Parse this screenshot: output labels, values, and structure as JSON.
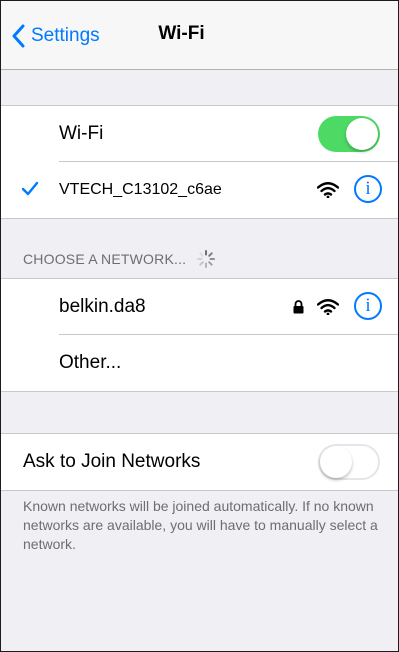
{
  "navbar": {
    "back_label": "Settings",
    "title": "Wi-Fi"
  },
  "wifi_toggle": {
    "label": "Wi-Fi",
    "on": true
  },
  "connected_network": {
    "name": "VTECH_C13102_c6ae",
    "secured": false,
    "info_glyph": "i"
  },
  "choose_network": {
    "header": "CHOOSE A NETWORK...",
    "networks": [
      {
        "name": "belkin.da8",
        "secured": true,
        "info_glyph": "i"
      }
    ],
    "other_label": "Other..."
  },
  "ask_to_join": {
    "label": "Ask to Join Networks",
    "on": false,
    "footer": "Known networks will be joined automatically. If no known networks are available, you will have to manually select a network."
  },
  "colors": {
    "accent": "#007aff",
    "toggle_on": "#4cd964",
    "background": "#efeff4"
  },
  "icons": [
    "chevron-left-icon",
    "checkmark-icon",
    "wifi-icon",
    "lock-icon",
    "info-icon",
    "spinner-icon"
  ]
}
